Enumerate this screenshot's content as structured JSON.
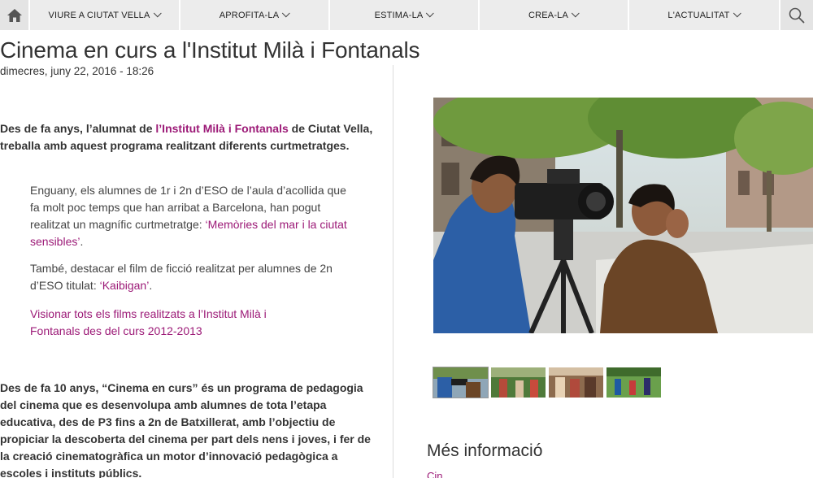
{
  "nav": {
    "items": [
      {
        "label": "VIURE A CIUTAT VELLA"
      },
      {
        "label": "APROFITA-LA"
      },
      {
        "label": "ESTIMA-LA"
      },
      {
        "label": "CREA-LA"
      },
      {
        "label": "L'ACTUALITAT"
      }
    ]
  },
  "article": {
    "title": "Cinema en curs a l'Institut Milà i Fontanals",
    "date": "dimecres, juny 22, 2016 - 18:26",
    "p1_before": "Des de fa anys, l’alumnat de ",
    "p1_link": "l’Institut Milà i Fontanals",
    "p1_after": " de Ciutat Vella, treballa amb aquest programa realitzant diferents curtmetratges.",
    "p2_before": "Enguany, els alumnes de 1r i 2n d’ESO de l’aula d’acollida que fa molt poc temps que han arribat a Barcelona, han pogut realitzat un magnífic curtmetratge: ",
    "p2_link": "‘Memòries del mar i la ciutat sensibles’",
    "p2_after": ".",
    "p3_before": "També, destacar el film de ficció realitzat per alumnes de 2n d’ESO titulat: ",
    "p3_link": "‘Kaibigan’",
    "p3_after": ".",
    "p4_link": "Visionar tots els films realitzats a l’Institut Milà i Fontanals des del curs 2012-2013",
    "p5": "Des de fa 10 anys, “Cinema en curs” és un programa de pedagogia del cinema que es desenvolupa amb alumnes de tota l’etapa educativa, des de P3 fins a 2n de Batxillerat, amb l’objectiu de propiciar la descoberta del cinema per part dels nens i joves, i fer de la creació cinematogràfica un motor d’innovació pedagògica a escoles i instituts públics."
  },
  "sidebar": {
    "more_info_heading": "Més informació",
    "more_info_link": "Cin..."
  },
  "colors": {
    "accent": "#9c1a77",
    "nav_bg": "#ececec"
  }
}
